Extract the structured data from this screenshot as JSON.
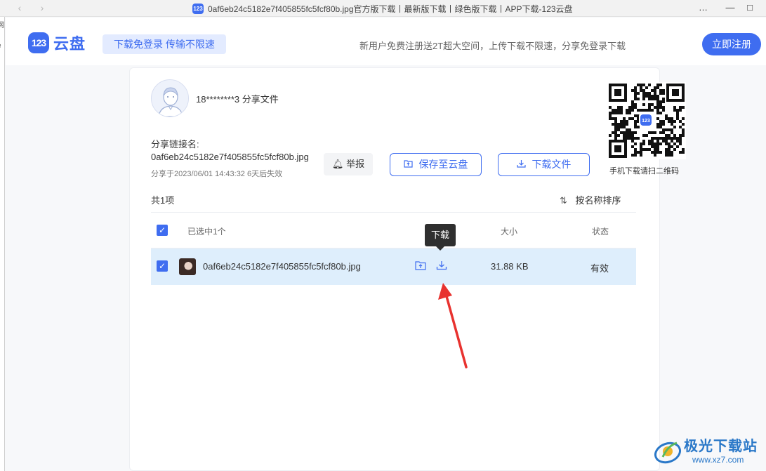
{
  "browser": {
    "title": "0af6eb24c5182e7f405855fc5fcf80b.jpg官方版下载丨最新版下载丨绿色版下载丨APP下载-123云盘",
    "logo_text": "123",
    "back_icon": "chevron-left-icon",
    "forward_icon": "chevron-right-icon",
    "more_icon": "more-horizontal-icon",
    "minimize_icon": "minimize-icon",
    "maximize_icon": "maximize-icon"
  },
  "left_strip": {
    "chars": [
      "网",
      "e"
    ]
  },
  "header": {
    "logo_badge": "123",
    "logo_text": "云盘",
    "promo": "下载免登录  传输不限速",
    "slogan": "新用户免费注册送2T超大空间，上传下载不限速，分享免登录下载",
    "register_label": "立即注册",
    "accent_color": "#3f6df0"
  },
  "share": {
    "user_line": "18********3 分享文件",
    "link_name_label": "分享链接名:",
    "file_name": "0af6eb24c5182e7f405855fc5fcf80b.jpg",
    "meta": "分享于2023/06/01 14:43:32 6天后失效",
    "report_label": "举报",
    "save_label": "保存至云盘",
    "download_label": "下载文件",
    "qr_caption": "手机下载请扫二维码",
    "qr_center_text": "123"
  },
  "list": {
    "count": "共1项",
    "sort_label": "按名称排序",
    "header": {
      "selected": "已选中1个",
      "size": "大小",
      "status": "状态"
    },
    "rows": [
      {
        "name": "0af6eb24c5182e7f405855fc5fcf80b.jpg",
        "size": "31.88 KB",
        "status": "有效",
        "checked": true
      }
    ],
    "tooltip": "下载"
  },
  "watermark": {
    "title": "极光下载站",
    "url": "www.xz7.com"
  }
}
